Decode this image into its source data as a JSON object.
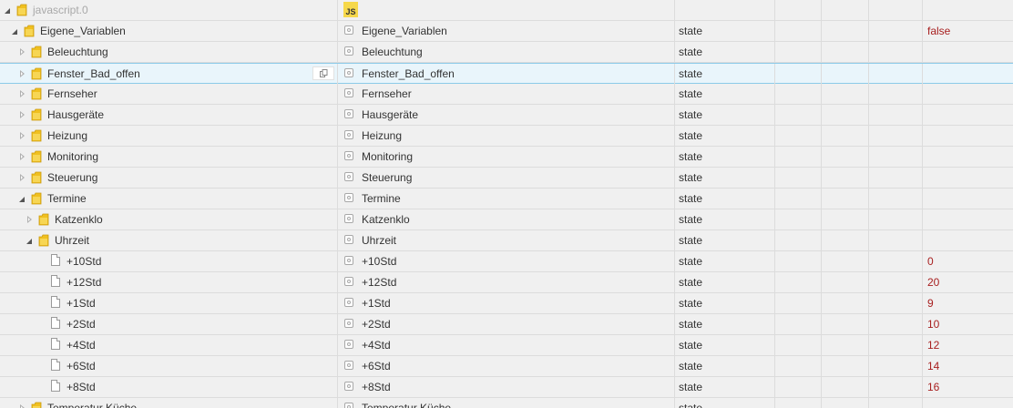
{
  "object_tree": {
    "rows": [
      {
        "name": "javascript.0",
        "label": "",
        "type": "",
        "value": "",
        "kind": "folder",
        "level": 0,
        "toggle": "open",
        "dim": true,
        "label_icon": "js",
        "selected": false
      },
      {
        "name": "Eigene_Variablen",
        "label": "Eigene_Variablen",
        "type": "state",
        "value": "false",
        "kind": "folder",
        "level": 1,
        "toggle": "open",
        "dim": false,
        "label_icon": "state",
        "selected": false
      },
      {
        "name": "Beleuchtung",
        "label": "Beleuchtung",
        "type": "state",
        "value": "",
        "kind": "folder",
        "level": 2,
        "toggle": "closed",
        "dim": false,
        "label_icon": "state",
        "selected": false
      },
      {
        "name": "Fenster_Bad_offen",
        "label": "Fenster_Bad_offen",
        "type": "state",
        "value": "",
        "kind": "folder",
        "level": 2,
        "toggle": "closed",
        "dim": false,
        "label_icon": "state",
        "selected": true
      },
      {
        "name": "Fernseher",
        "label": "Fernseher",
        "type": "state",
        "value": "",
        "kind": "folder",
        "level": 2,
        "toggle": "closed",
        "dim": false,
        "label_icon": "state",
        "selected": false
      },
      {
        "name": "Hausgeräte",
        "label": "Hausgeräte",
        "type": "state",
        "value": "",
        "kind": "folder",
        "level": 2,
        "toggle": "closed",
        "dim": false,
        "label_icon": "state",
        "selected": false
      },
      {
        "name": "Heizung",
        "label": "Heizung",
        "type": "state",
        "value": "",
        "kind": "folder",
        "level": 2,
        "toggle": "closed",
        "dim": false,
        "label_icon": "state",
        "selected": false
      },
      {
        "name": "Monitoring",
        "label": "Monitoring",
        "type": "state",
        "value": "",
        "kind": "folder",
        "level": 2,
        "toggle": "closed",
        "dim": false,
        "label_icon": "state",
        "selected": false
      },
      {
        "name": "Steuerung",
        "label": "Steuerung",
        "type": "state",
        "value": "",
        "kind": "folder",
        "level": 2,
        "toggle": "closed",
        "dim": false,
        "label_icon": "state",
        "selected": false
      },
      {
        "name": "Termine",
        "label": "Termine",
        "type": "state",
        "value": "",
        "kind": "folder",
        "level": 2,
        "toggle": "open",
        "dim": false,
        "label_icon": "state",
        "selected": false
      },
      {
        "name": "Katzenklo",
        "label": "Katzenklo",
        "type": "state",
        "value": "",
        "kind": "folder",
        "level": 3,
        "toggle": "closed",
        "dim": false,
        "label_icon": "state",
        "selected": false
      },
      {
        "name": "Uhrzeit",
        "label": "Uhrzeit",
        "type": "state",
        "value": "",
        "kind": "folder",
        "level": 3,
        "toggle": "open",
        "dim": false,
        "label_icon": "state",
        "selected": false
      },
      {
        "name": "+10Std",
        "label": "+10Std",
        "type": "state",
        "value": "0",
        "kind": "file",
        "level": 4,
        "toggle": "none",
        "dim": false,
        "label_icon": "state",
        "selected": false
      },
      {
        "name": "+12Std",
        "label": "+12Std",
        "type": "state",
        "value": "20",
        "kind": "file",
        "level": 4,
        "toggle": "none",
        "dim": false,
        "label_icon": "state",
        "selected": false
      },
      {
        "name": "+1Std",
        "label": "+1Std",
        "type": "state",
        "value": "9",
        "kind": "file",
        "level": 4,
        "toggle": "none",
        "dim": false,
        "label_icon": "state",
        "selected": false
      },
      {
        "name": "+2Std",
        "label": "+2Std",
        "type": "state",
        "value": "10",
        "kind": "file",
        "level": 4,
        "toggle": "none",
        "dim": false,
        "label_icon": "state",
        "selected": false
      },
      {
        "name": "+4Std",
        "label": "+4Std",
        "type": "state",
        "value": "12",
        "kind": "file",
        "level": 4,
        "toggle": "none",
        "dim": false,
        "label_icon": "state",
        "selected": false
      },
      {
        "name": "+6Std",
        "label": "+6Std",
        "type": "state",
        "value": "14",
        "kind": "file",
        "level": 4,
        "toggle": "none",
        "dim": false,
        "label_icon": "state",
        "selected": false
      },
      {
        "name": "+8Std",
        "label": "+8Std",
        "type": "state",
        "value": "16",
        "kind": "file",
        "level": 4,
        "toggle": "none",
        "dim": false,
        "label_icon": "state",
        "selected": false
      },
      {
        "name": "Temperatur Küche",
        "label": "Temperatur Küche",
        "type": "state",
        "value": "",
        "kind": "folder",
        "level": 2,
        "toggle": "closed",
        "dim": false,
        "label_icon": "state",
        "selected": false
      }
    ],
    "js_icon_text": "JS",
    "copy_icon": "copy-icon",
    "colors": {
      "value": "#a82020",
      "folder": "#f0c020",
      "selected_bg": "#e9f5fb",
      "selected_border": "#8ccbe8"
    }
  }
}
